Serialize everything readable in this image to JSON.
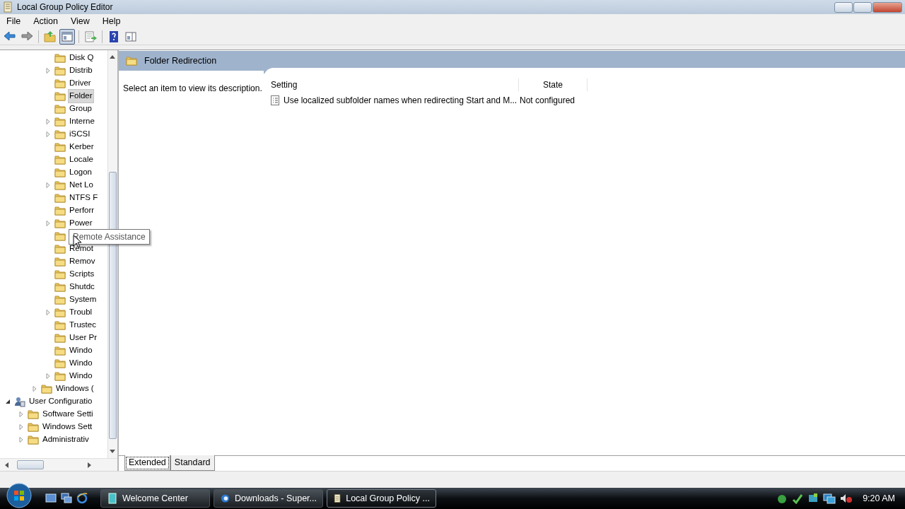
{
  "window": {
    "title": "Local Group Policy Editor"
  },
  "menu": [
    "File",
    "Action",
    "View",
    "Help"
  ],
  "toolbar": [
    {
      "kind": "back",
      "pressed": false
    },
    {
      "kind": "forward",
      "pressed": false
    },
    {
      "kind": "sep"
    },
    {
      "kind": "up",
      "pressed": false
    },
    {
      "kind": "tree",
      "pressed": true
    },
    {
      "kind": "sep"
    },
    {
      "kind": "export",
      "pressed": false
    },
    {
      "kind": "sep"
    },
    {
      "kind": "help",
      "pressed": false
    },
    {
      "kind": "panel",
      "pressed": false
    }
  ],
  "tree": [
    {
      "children": [
        {
          "children": [
            {
              "children": [
                {
                  "label": "Disk Q",
                  "expandable": false,
                  "selected": false
                },
                {
                  "label": "Distrib",
                  "expandable": true,
                  "selected": false
                },
                {
                  "label": "Driver",
                  "expandable": false,
                  "selected": false
                },
                {
                  "label": "Folder",
                  "expandable": false,
                  "selected": true
                },
                {
                  "label": "Group",
                  "expandable": false,
                  "selected": false
                },
                {
                  "label": "Interne",
                  "expandable": true,
                  "selected": false
                },
                {
                  "label": "iSCSI",
                  "expandable": true,
                  "selected": false
                },
                {
                  "label": "Kerber",
                  "expandable": false,
                  "selected": false
                },
                {
                  "label": "Locale",
                  "expandable": false,
                  "selected": false
                },
                {
                  "label": "Logon",
                  "expandable": false,
                  "selected": false
                },
                {
                  "label": "Net Lo",
                  "expandable": true,
                  "selected": false
                },
                {
                  "label": "NTFS F",
                  "expandable": false,
                  "selected": false
                },
                {
                  "label": "Perforr",
                  "expandable": false,
                  "selected": false
                },
                {
                  "label": "Power",
                  "expandable": true,
                  "selected": false
                },
                {
                  "kind": "covered"
                },
                {
                  "label": "Remot",
                  "expandable": false,
                  "selected": false
                },
                {
                  "label": "Remov",
                  "expandable": false,
                  "selected": false
                },
                {
                  "label": "Scripts",
                  "expandable": false,
                  "selected": false
                },
                {
                  "label": "Shutdc",
                  "expandable": false,
                  "selected": false
                },
                {
                  "label": "System",
                  "expandable": false,
                  "selected": false
                },
                {
                  "label": "Troubl",
                  "expandable": true,
                  "selected": false
                },
                {
                  "label": "Trustec",
                  "expandable": false,
                  "selected": false
                },
                {
                  "label": "User Pr",
                  "expandable": false,
                  "selected": false
                },
                {
                  "label": "Windo",
                  "expandable": false,
                  "selected": false
                },
                {
                  "label": "Windo",
                  "expandable": false,
                  "selected": false
                },
                {
                  "label": "Windo",
                  "expandable": true,
                  "selected": false
                }
              ]
            },
            {
              "label": "Windows (",
              "expandable": true,
              "selected": false
            }
          ]
        }
      ]
    },
    {
      "label": "User Configuratio",
      "kind": "computer",
      "expanded": true,
      "selected": false,
      "children": [
        {
          "label": "Software Setti",
          "expandable": true,
          "selected": false
        },
        {
          "label": "Windows Sett",
          "expandable": true,
          "selected": false
        },
        {
          "label": "Administrativ",
          "expandable": true,
          "selected": false
        }
      ]
    }
  ],
  "tooltip": "Remote Assistance",
  "details": {
    "heading": "Folder Redirection",
    "description": "Select an item to view its description.",
    "columns": [
      "Setting",
      "State"
    ],
    "rows": [
      {
        "setting": "Use localized subfolder names when redirecting Start and M...",
        "state": "Not configured"
      }
    ]
  },
  "view_tabs": [
    {
      "label": "Extended",
      "selected": true
    },
    {
      "label": "Standard",
      "selected": false
    }
  ],
  "taskbar": {
    "buttons": [
      {
        "label": "Welcome Center",
        "kind": "welcome",
        "selected": false
      },
      {
        "label": "Downloads - Super...",
        "kind": "browser",
        "selected": false
      },
      {
        "label": "Local Group Policy ...",
        "kind": "policy",
        "selected": true
      }
    ],
    "clock": "9:20 AM"
  }
}
